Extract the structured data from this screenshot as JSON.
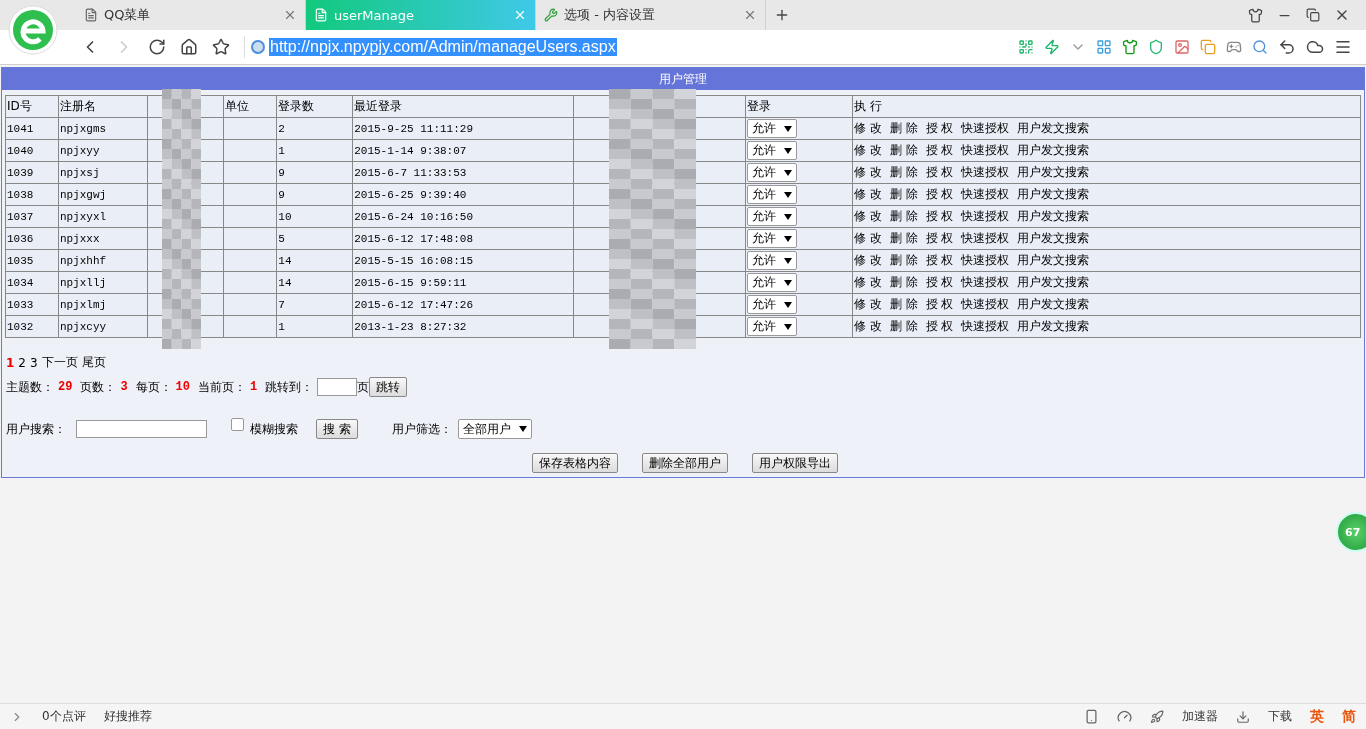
{
  "browser": {
    "tabs": [
      {
        "title": "QQ菜单",
        "kind": "page",
        "selected": false
      },
      {
        "title": "userManage",
        "kind": "page",
        "selected": true
      },
      {
        "title": "选项 - 内容设置",
        "kind": "settings",
        "selected": false
      }
    ],
    "url": "http://npjx.npypjy.com/Admin/manageUsers.aspx"
  },
  "panel": {
    "title": "用户管理",
    "columns": [
      {
        "label": "ID号"
      },
      {
        "label": "注册名"
      },
      {
        "kind": "masked"
      },
      {
        "label": "单位"
      },
      {
        "label": "登录数"
      },
      {
        "label": "最近登录"
      },
      {
        "kind": "masked"
      },
      {
        "label": "登录"
      },
      {
        "label": "执 行"
      }
    ],
    "rows": [
      {
        "id": "1041",
        "username": "npjxgms",
        "logins": "2",
        "last_login": "2015-9-25 11:11:29",
        "login": "允许",
        "actions": [
          "修 改",
          "删 除",
          "授 权",
          "快速授权",
          "用户发文搜索"
        ]
      },
      {
        "id": "1040",
        "username": "npjxyy",
        "logins": "1",
        "last_login": "2015-1-14 9:38:07",
        "login": "允许",
        "actions": [
          "修 改",
          "删 除",
          "授 权",
          "快速授权",
          "用户发文搜索"
        ]
      },
      {
        "id": "1039",
        "username": "npjxsj",
        "logins": "9",
        "last_login": "2015-6-7 11:33:53",
        "login": "允许",
        "actions": [
          "修 改",
          "删 除",
          "授 权",
          "快速授权",
          "用户发文搜索"
        ]
      },
      {
        "id": "1038",
        "username": "npjxgwj",
        "logins": "9",
        "last_login": "2015-6-25 9:39:40",
        "login": "允许",
        "actions": [
          "修 改",
          "删 除",
          "授 权",
          "快速授权",
          "用户发文搜索"
        ]
      },
      {
        "id": "1037",
        "username": "npjxyxl",
        "logins": "10",
        "last_login": "2015-6-24 10:16:50",
        "login": "允许",
        "actions": [
          "修 改",
          "删 除",
          "授 权",
          "快速授权",
          "用户发文搜索"
        ]
      },
      {
        "id": "1036",
        "username": "npjxxx",
        "logins": "5",
        "last_login": "2015-6-12 17:48:08",
        "login": "允许",
        "actions": [
          "修 改",
          "删 除",
          "授 权",
          "快速授权",
          "用户发文搜索"
        ]
      },
      {
        "id": "1035",
        "username": "npjxhhf",
        "logins": "14",
        "last_login": "2015-5-15 16:08:15",
        "login": "允许",
        "actions": [
          "修 改",
          "删 除",
          "授 权",
          "快速授权",
          "用户发文搜索"
        ]
      },
      {
        "id": "1034",
        "username": "npjxllj",
        "logins": "14",
        "last_login": "2015-6-15 9:59:11",
        "login": "允许",
        "actions": [
          "修 改",
          "删 除",
          "授 权",
          "快速授权",
          "用户发文搜索"
        ]
      },
      {
        "id": "1033",
        "username": "npjxlmj",
        "logins": "7",
        "last_login": "2015-6-12 17:47:26",
        "login": "允许",
        "actions": [
          "修 改",
          "删 除",
          "授 权",
          "快速授权",
          "用户发文搜索"
        ]
      },
      {
        "id": "1032",
        "username": "npjxcyy",
        "logins": "1",
        "last_login": "2013-1-23 8:27:32",
        "login": "允许",
        "actions": [
          "修 改",
          "删 除",
          "授 权",
          "快速授权",
          "用户发文搜索"
        ]
      }
    ],
    "pager": [
      {
        "label": "1",
        "selected": true
      },
      {
        "label": "2",
        "selected": false
      },
      {
        "label": "3",
        "selected": false
      },
      {
        "label": "下一页",
        "selected": false
      },
      {
        "label": "尾页",
        "selected": false
      }
    ],
    "stats": [
      {
        "label": "主题数：",
        "value": "29"
      },
      {
        "label": "页数：",
        "value": "3"
      },
      {
        "label": "每页：",
        "value": "10"
      },
      {
        "label": "当前页：",
        "value": "1"
      }
    ],
    "jump": {
      "label": "跳转到：",
      "unit": "页",
      "button": "跳转"
    },
    "search": {
      "label": "用户搜索：",
      "fuzzy_label": "模糊搜索",
      "fuzzy_checked": false,
      "button": "搜 索",
      "filter_label": "用户筛选：",
      "filter_value": "全部用户"
    },
    "buttons": [
      "保存表格内容",
      "删除全部用户",
      "用户权限导出"
    ]
  },
  "float_badge": "67",
  "status_bar": {
    "left": [
      "0个点评",
      "好搜推荐"
    ],
    "right": [
      "加速器",
      "下载"
    ],
    "ime": [
      "英",
      "简"
    ]
  }
}
